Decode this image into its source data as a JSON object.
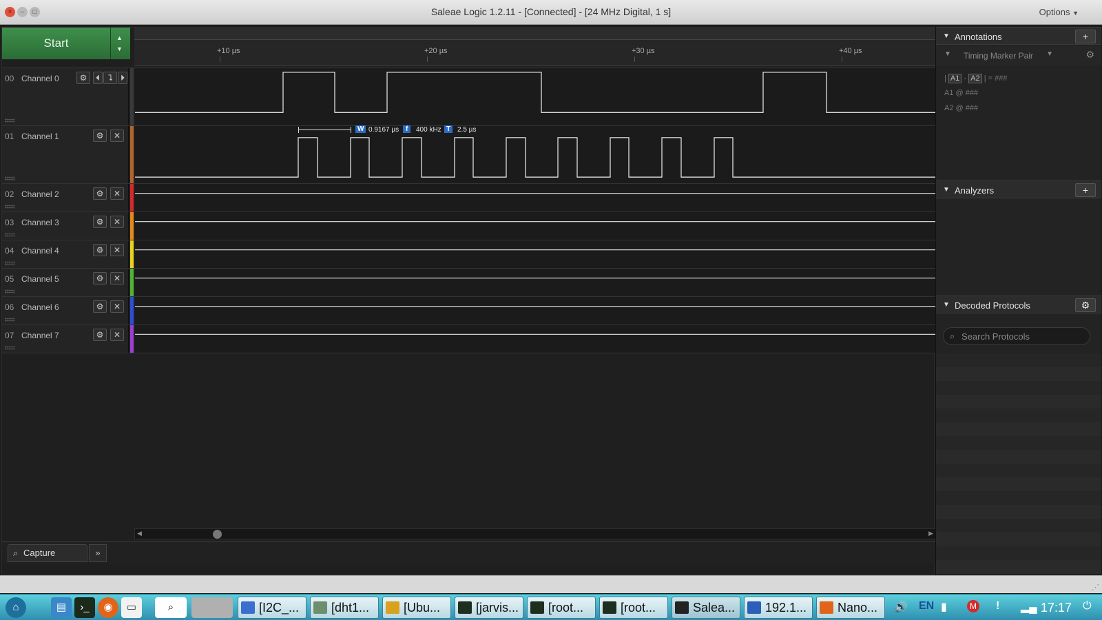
{
  "window": {
    "title": "Saleae Logic 1.2.11 - [Connected] - [24 MHz Digital, 1 s]",
    "options_label": "Options",
    "close_glyph": "×",
    "min_glyph": "–",
    "max_glyph": "□"
  },
  "capture": {
    "start_label": "Start",
    "ruler_ticks": [
      "+10 µs",
      "+20 µs",
      "+30 µs",
      "+40 µs"
    ]
  },
  "measurement": {
    "width_label": "W",
    "width_value": "0.9167 µs",
    "freq_label": "f",
    "freq_value": "400 kHz",
    "period_label": "T",
    "period_value": "2.5 µs"
  },
  "channels": [
    {
      "num": "00",
      "name": "Channel 0",
      "color": "#3a3a3a"
    },
    {
      "num": "01",
      "name": "Channel 1",
      "color": "#b0652a"
    },
    {
      "num": "02",
      "name": "Channel 2",
      "color": "#d42a2a"
    },
    {
      "num": "03",
      "name": "Channel 3",
      "color": "#e38a1d"
    },
    {
      "num": "04",
      "name": "Channel 4",
      "color": "#e8d21d"
    },
    {
      "num": "05",
      "name": "Channel 5",
      "color": "#52b235"
    },
    {
      "num": "06",
      "name": "Channel 6",
      "color": "#2b4fd6"
    },
    {
      "num": "07",
      "name": "Channel 7",
      "color": "#9a3fd0"
    }
  ],
  "icons": {
    "gear": "⚙",
    "close": "✕",
    "prev": "⏴",
    "edge": "⮧",
    "next": "⏵",
    "up": "▲",
    "down": "▼"
  },
  "bottom_tabs": {
    "capture_label": "Capture",
    "more_label": "»"
  },
  "annotations": {
    "header": "Annotations",
    "add_glyph": "+",
    "marker_label": "Timing Marker Pair",
    "a1": "A1",
    "a2": "A2",
    "diff_value": "###",
    "a1_value": "###",
    "a2_value": "###"
  },
  "analyzers": {
    "header": "Analyzers",
    "add_glyph": "+"
  },
  "decoded_protocols": {
    "header": "Decoded Protocols",
    "search_placeholder": "Search Protocols"
  },
  "taskbar": {
    "tasks": [
      {
        "label": "[I2C_...",
        "color": "#3b6fcf"
      },
      {
        "label": "[dht1...",
        "color": "#6d8f6d"
      },
      {
        "label": "[Ubu...",
        "color": "#d8a21f"
      },
      {
        "label": "[jarvis...",
        "color": "#1f2f1f"
      },
      {
        "label": "[root...",
        "color": "#1f2f1f"
      },
      {
        "label": "[root...",
        "color": "#1f2f1f"
      },
      {
        "label": "Salea...",
        "color": "#222222"
      },
      {
        "label": "192.1...",
        "color": "#2d5fb8"
      },
      {
        "label": "Nano...",
        "color": "#e0651a"
      }
    ],
    "lang": "EN",
    "time": "17:17"
  }
}
